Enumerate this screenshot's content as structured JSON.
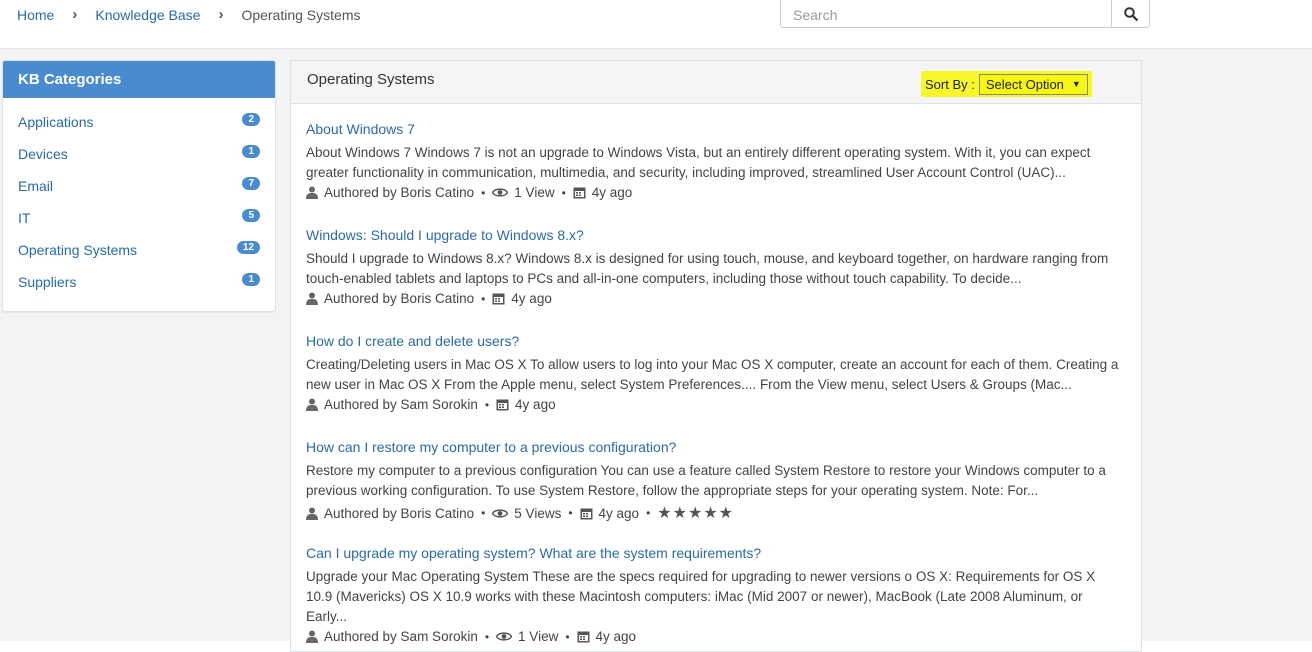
{
  "breadcrumb": {
    "home": "Home",
    "kb": "Knowledge Base",
    "current": "Operating Systems"
  },
  "search": {
    "placeholder": "Search",
    "value": ""
  },
  "sidebar": {
    "title": "KB Categories",
    "items": [
      {
        "label": "Applications",
        "count": "2"
      },
      {
        "label": "Devices",
        "count": "1"
      },
      {
        "label": "Email",
        "count": "7"
      },
      {
        "label": "IT",
        "count": "5"
      },
      {
        "label": "Operating Systems",
        "count": "12"
      },
      {
        "label": "Suppliers",
        "count": "1"
      }
    ]
  },
  "main": {
    "title": "Operating Systems",
    "sort_label": "Sort By :",
    "sort_value": "Select Option",
    "articles": [
      {
        "title": "About Windows 7",
        "excerpt": "About Windows 7 Windows 7 is not an upgrade to Windows Vista, but an entirely different operating system. With it, you can expect greater functionality in communication, multimedia, and security, including improved, streamlined User Account Control (UAC)...",
        "author": "Authored by Boris Catino",
        "views": "1 View",
        "age": "4y ago"
      },
      {
        "title": "Windows: Should I upgrade to Windows 8.x?",
        "excerpt": "   Should I upgrade to Windows 8.x? Windows 8.x is designed for using touch, mouse, and keyboard together, on hardware ranging from touch-enabled tablets and laptops to PCs and all-in-one computers, including those without touch capability.  To decide...",
        "author": "Authored by Boris Catino",
        "age": "4y ago"
      },
      {
        "title": "How do I create and delete users?",
        "excerpt": "  Creating/Deleting users in Mac OS X To allow users to log into your Mac OS X computer, create an account for each of them. Creating a new user in Mac OS X From the Apple menu, select System Preferences....  From the View menu, select Users & Groups (Mac...",
        "author": "Authored by Sam Sorokin",
        "age": "4y ago"
      },
      {
        "title": "How can I restore my computer to a previous configuration?",
        "excerpt": "Restore my computer to a previous configuration You can use a feature called System Restore to restore your Windows computer to a previous working configuration. To use System Restore, follow the appropriate steps for your operating system. Note: For...",
        "author": "Authored by Boris Catino",
        "views": "5 Views",
        "age": "4y ago",
        "stars": "★★★★★"
      },
      {
        "title": "Can I upgrade my operating system? What are the system requirements?",
        "excerpt": "Upgrade your Mac Operating System These are the specs required for upgrading to newer versions o OS X: Requirements for OS X 10.9 (Mavericks) OS X 10.9 works with these Macintosh computers: iMac (Mid 2007 or newer), MacBook (Late 2008 Aluminum, or Early...",
        "author": "Authored by Sam Sorokin",
        "views": "1 View",
        "age": "4y ago"
      }
    ]
  },
  "colors": {
    "accent": "#4a8bd0",
    "link": "#2a6aa8",
    "highlight": "#f7f72a"
  },
  "icons": {
    "author": "user-icon",
    "views": "eye-icon",
    "date": "calendar-icon",
    "search": "search-icon",
    "breadcrumb_sep": "chevron-right-icon"
  }
}
